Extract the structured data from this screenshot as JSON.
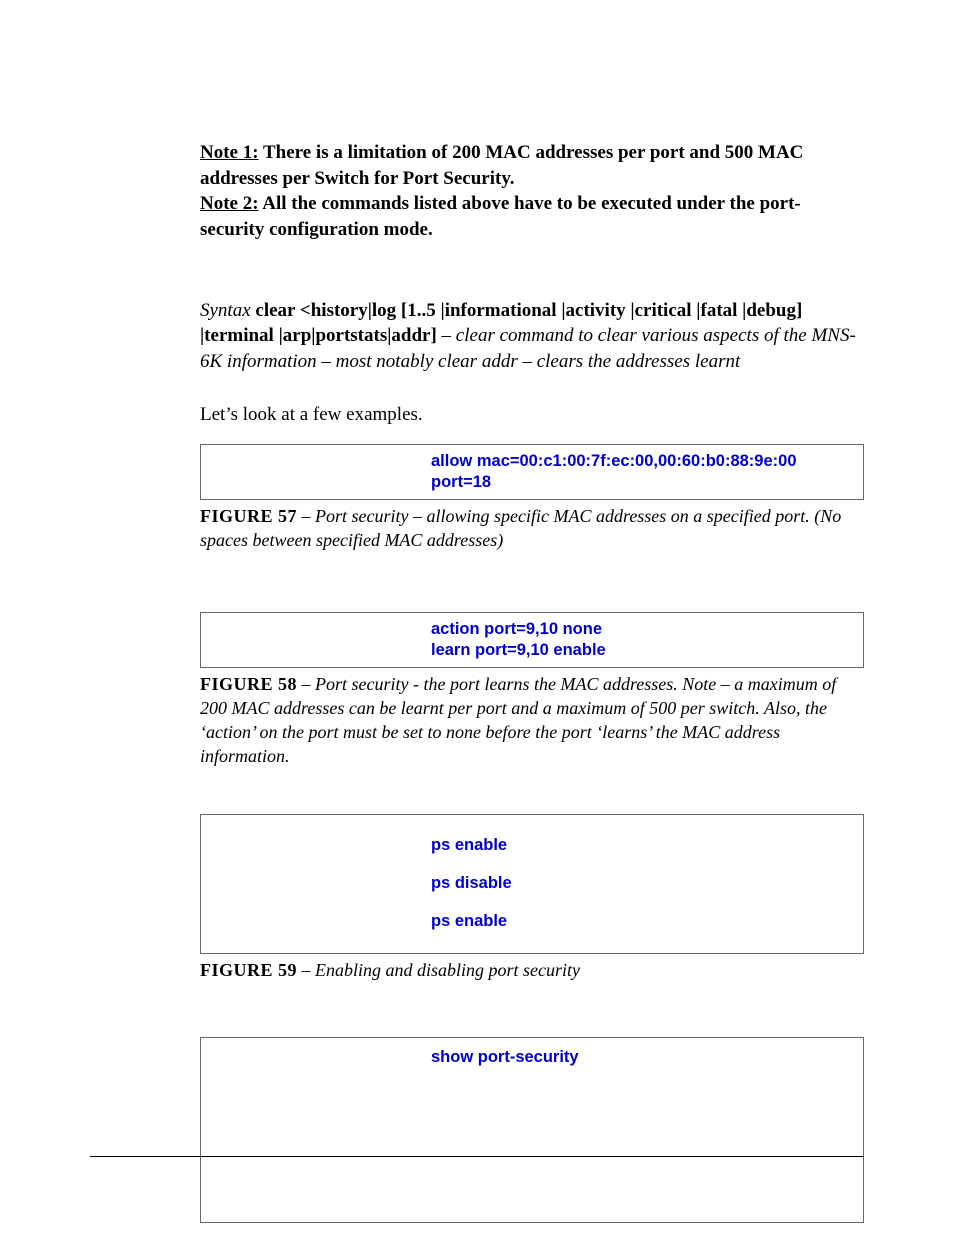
{
  "notes": {
    "note1_label": "Note 1:",
    "note1_body": " There is a limitation of 200 MAC addresses per port and 500 MAC addresses per Switch for Port Security.",
    "note2_label": "Note 2:",
    "note2_body": " All the commands listed above have to be executed under the port-security configuration mode."
  },
  "syntax": {
    "label": "Syntax",
    "cmd": "  clear <history|log [1..5 |informational |activity |critical |fatal |debug] |terminal |arp|portstats|addr]",
    "desc": " – clear command to clear various aspects of the MNS-6K information – most notably clear addr – clears the addresses learnt"
  },
  "intro": "Let’s look at a few examples.",
  "code1": {
    "line1": "allow mac=00:c1:00:7f:ec:00,00:60:b0:88:9e:00",
    "line2": "port=18"
  },
  "figure57": {
    "label": "FIGURE 57",
    "body": " – Port security – allowing specific MAC addresses on a specified port. (No spaces between specified MAC addresses)"
  },
  "code2": {
    "line1": "action port=9,10 none",
    "line2": "learn port=9,10 enable"
  },
  "figure58": {
    "label": "FIGURE 58",
    "body": " – Port security - the port learns the MAC addresses. Note – a maximum of 200 MAC addresses can be learnt per port and a maximum of 500 per switch. Also, the ‘action’ on the port must be set to none before the port ‘learns’ the MAC address information."
  },
  "code3": {
    "line1": "ps enable",
    "line2": "ps disable",
    "line3": "ps enable"
  },
  "figure59": {
    "label": "FIGURE 59",
    "body": " – Enabling and disabling port security"
  },
  "code4": {
    "line1": "show port-security"
  }
}
